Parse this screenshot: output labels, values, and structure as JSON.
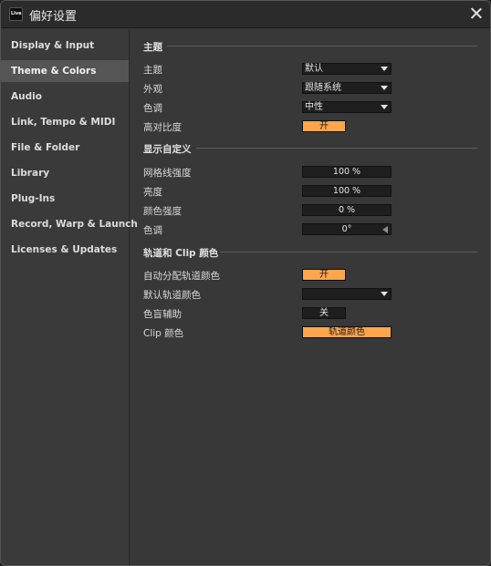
{
  "window": {
    "title": "偏好设置",
    "app_icon_text": "Live"
  },
  "sidebar": {
    "items": [
      {
        "label": "Display & Input"
      },
      {
        "label": "Theme & Colors"
      },
      {
        "label": "Audio"
      },
      {
        "label": "Link, Tempo & MIDI"
      },
      {
        "label": "File & Folder"
      },
      {
        "label": "Library"
      },
      {
        "label": "Plug-Ins"
      },
      {
        "label": "Record, Warp & Launch"
      },
      {
        "label": "Licenses & Updates"
      }
    ],
    "active_index": 1
  },
  "theme": {
    "section_title": "主题",
    "theme_label": "主题",
    "theme_value": "默认",
    "appearance_label": "外观",
    "appearance_value": "跟随系统",
    "tone_label": "色调",
    "tone_value": "中性",
    "contrast_label": "高对比度",
    "contrast_value": "开"
  },
  "custom": {
    "section_title": "显示自定义",
    "grid_label": "网格线强度",
    "grid_value": "100 %",
    "brightness_label": "亮度",
    "brightness_value": "100 %",
    "saturation_label": "颜色强度",
    "saturation_value": "0 %",
    "hue_label": "色调",
    "hue_value": "0°"
  },
  "track_clip": {
    "section_title": "轨道和 Clip 颜色",
    "auto_assign_label": "自动分配轨道颜色",
    "auto_assign_value": "开",
    "default_track_label": "默认轨道颜色",
    "default_track_value": "",
    "colorblind_label": "色盲辅助",
    "colorblind_value": "关",
    "clip_color_label": "Clip 颜色",
    "clip_color_value": "轨道颜色"
  },
  "colors": {
    "accent": "#ffa64d",
    "panel": "#383838",
    "field": "#1e1e1e",
    "sidebar_active": "#555555"
  }
}
